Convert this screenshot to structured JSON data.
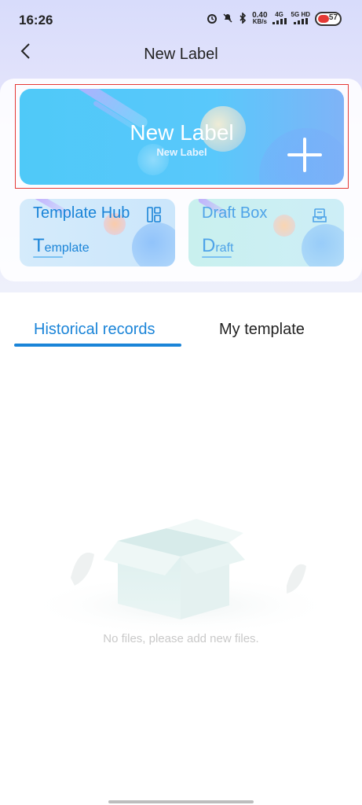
{
  "status_bar": {
    "time": "16:26",
    "net_speed_value": "0.40",
    "net_speed_unit": "KB/s",
    "signal1_label": "4G",
    "signal2_label": "5G HD",
    "battery_level": "57"
  },
  "header": {
    "title": "New Label"
  },
  "hero": {
    "title": "New Label",
    "subtitle": "New Label"
  },
  "cards": [
    {
      "title": "Template Hub",
      "sub_initial": "T",
      "sub_rest": "emplate",
      "icon": "template-grid-icon"
    },
    {
      "title": "Draft Box",
      "sub_initial": "D",
      "sub_rest": "raft",
      "icon": "draft-tray-icon"
    }
  ],
  "tabs": [
    {
      "label": "Historical records",
      "active": true
    },
    {
      "label": "My template",
      "active": false
    }
  ],
  "empty_state": {
    "message": "No files, please add new files."
  },
  "colors": {
    "accent": "#1a84d8",
    "hero_bg": "#59c8fb",
    "selection_outline": "#e53935"
  }
}
